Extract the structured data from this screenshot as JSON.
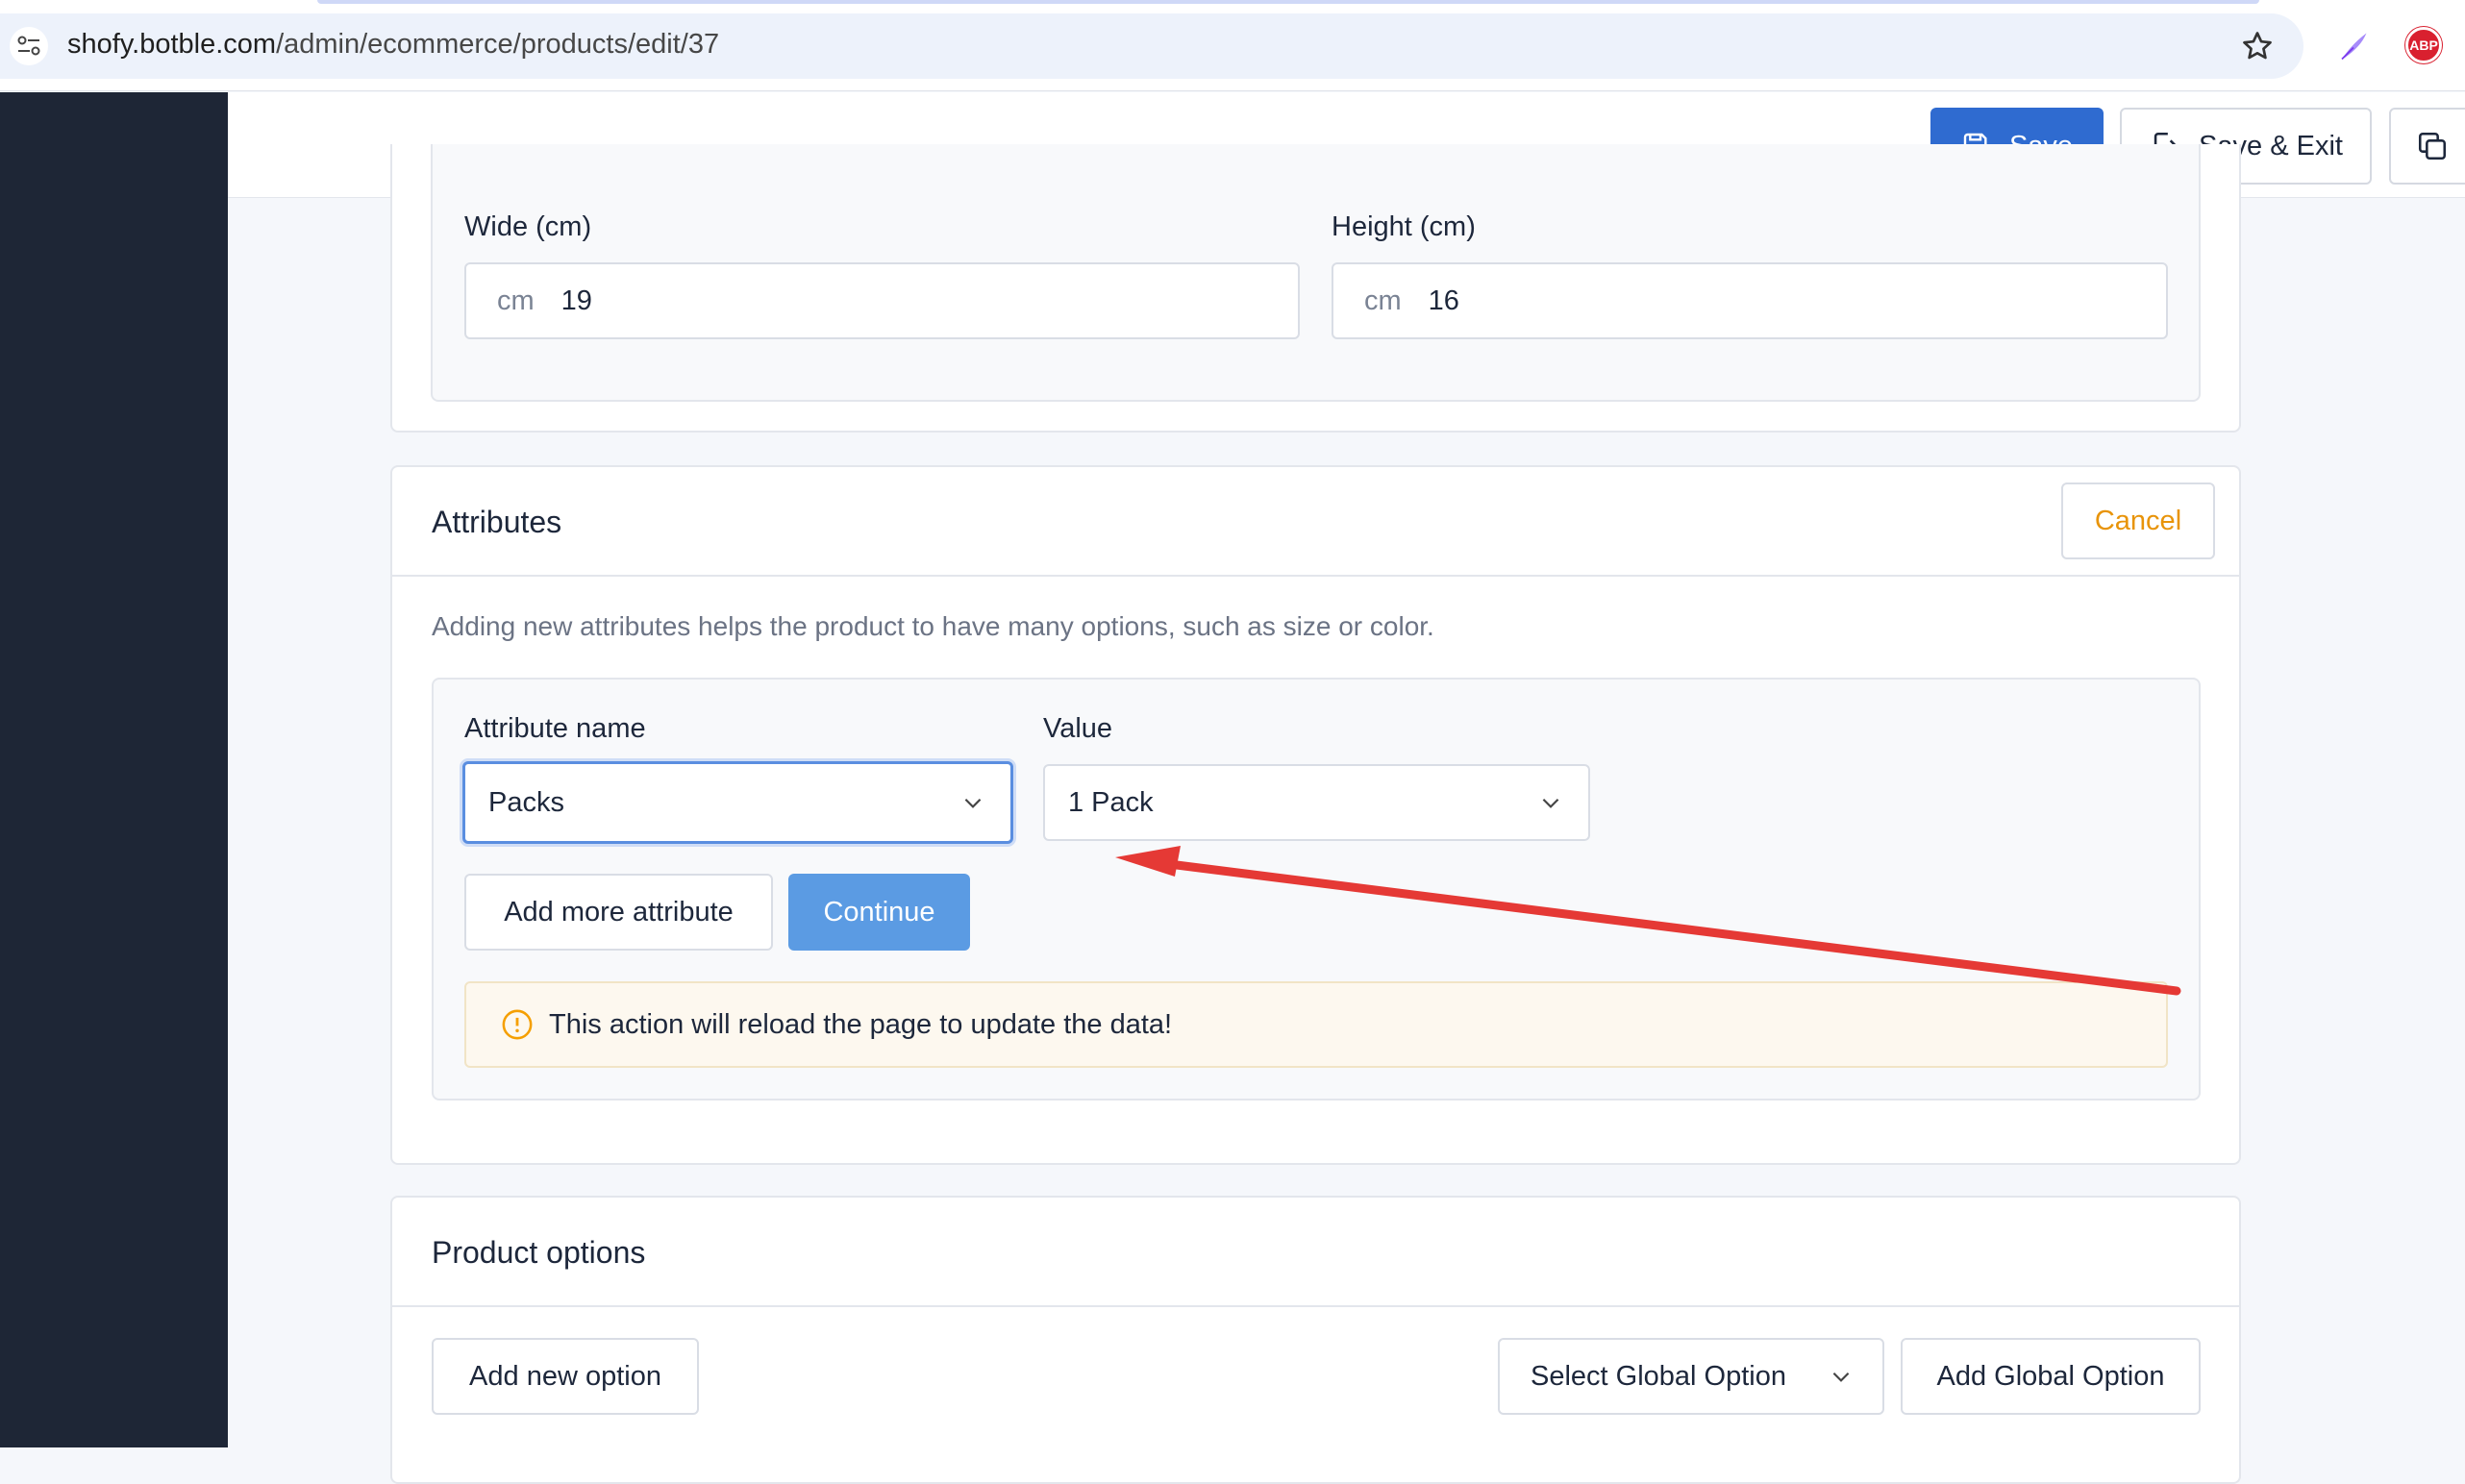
{
  "browser": {
    "url_host": "shofy.botble.com",
    "url_path": "/admin/ecommerce/products/edit/37",
    "icons": [
      "tune-icon",
      "star-icon",
      "quill-icon",
      "abp-icon"
    ],
    "abp_text": "ABP"
  },
  "toolbar": {
    "save_label": "Save",
    "save_exit_label": "Save & Exit",
    "primary_color": "#2f6bd0"
  },
  "shipping": {
    "wide_label": "Wide (cm)",
    "wide_unit": "cm",
    "wide_value": "19",
    "height_label": "Height (cm)",
    "height_unit": "cm",
    "height_value": "16"
  },
  "attributes": {
    "title": "Attributes",
    "cancel_label": "Cancel",
    "description": "Adding new attributes helps the product to have many options, such as size or color.",
    "attribute_name_label": "Attribute name",
    "attribute_name_value": "Packs",
    "value_label": "Value",
    "value_value": "1 Pack",
    "add_more_label": "Add more attribute",
    "continue_label": "Continue",
    "warning_text": "This action will reload the page to update the data!",
    "warning_color": "#f59f00"
  },
  "product_options": {
    "title": "Product options",
    "add_new_label": "Add new option",
    "select_global_placeholder": "Select Global Option",
    "add_global_label": "Add Global Option"
  },
  "annotation": {
    "arrow_color": "#e53935"
  }
}
